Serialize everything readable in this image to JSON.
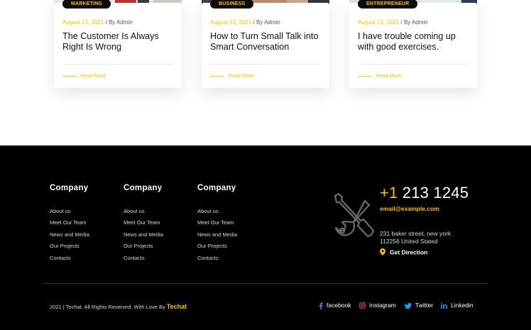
{
  "blog": {
    "cards": [
      {
        "tag": "Marketing",
        "date": "August 13, 2021",
        "by": "/ By Admin",
        "title": "The Customer Is Always Right Is Wrong",
        "read_more": "Read More"
      },
      {
        "tag": "Business",
        "date": "August 13, 2021",
        "by": "/ By Admin",
        "title": "How to Turn Small Talk into Smart Conversation",
        "read_more": "Read More"
      },
      {
        "tag": "Entrepreneur",
        "date": "August 13, 2021",
        "by": "/ By Admin",
        "title": "I have trouble coming up with good exercises.",
        "read_more": "Read More"
      }
    ]
  },
  "footer": {
    "columns": [
      {
        "title": "Company",
        "links": [
          "About us",
          "Meet Our Team",
          "News and Media",
          "Our Projects",
          "Contacts"
        ]
      },
      {
        "title": "Company",
        "links": [
          "About us",
          "Meet Our Team",
          "News and Media",
          "Our Projects",
          "Contacts"
        ]
      },
      {
        "title": "Company",
        "links": [
          "About us",
          "Meet Our Team",
          "News and Media",
          "Our Projects",
          "Contacts"
        ]
      }
    ],
    "contact": {
      "phone_prefix": "+1",
      "phone_number": "213 1245",
      "email": "email@example.com",
      "address_line1": "231 baker street, new york",
      "address_line2": "112256 United Stated",
      "direction_label": "Get Direction"
    },
    "copyright_text": "2021 | Techat. All Rights Reserved. With Love By",
    "brand": "Techat",
    "social": [
      {
        "label": "facebook",
        "icon": "facebook-icon"
      },
      {
        "label": "Instagram",
        "icon": "instagram-icon"
      },
      {
        "label": "Twitter",
        "icon": "twitter-icon"
      },
      {
        "label": "Linkedin",
        "icon": "linkedin-icon"
      }
    ]
  },
  "colors": {
    "accent": "#f6c20a",
    "footer_bg": "#000000",
    "text_dark": "#111111"
  }
}
